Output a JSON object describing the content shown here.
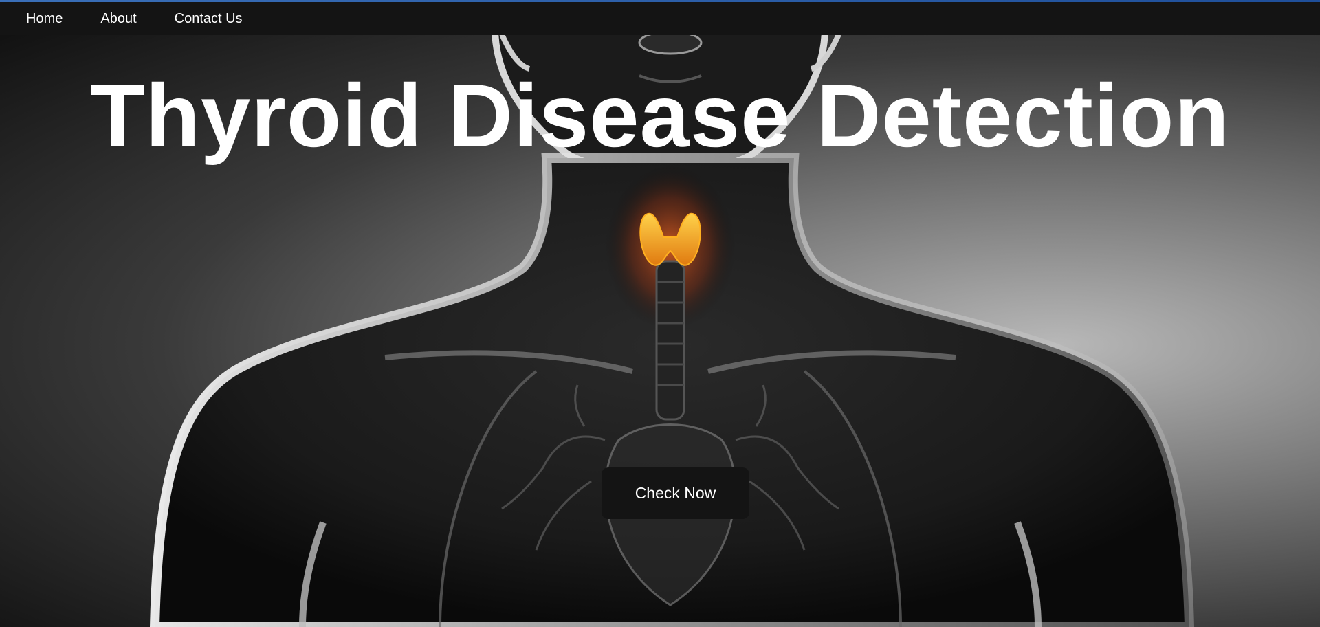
{
  "nav": {
    "items": [
      {
        "label": "Home"
      },
      {
        "label": "About"
      },
      {
        "label": "Contact Us"
      }
    ]
  },
  "hero": {
    "title": "Thyroid Disease Detection",
    "cta_label": "Check Now",
    "illustration": "x-ray-torso-with-highlighted-thyroid"
  },
  "colors": {
    "navbar_bg": "#141414",
    "accent_line": "#2f63b0",
    "thyroid": "#f0a020",
    "text": "#ffffff",
    "button_bg": "#141414"
  }
}
